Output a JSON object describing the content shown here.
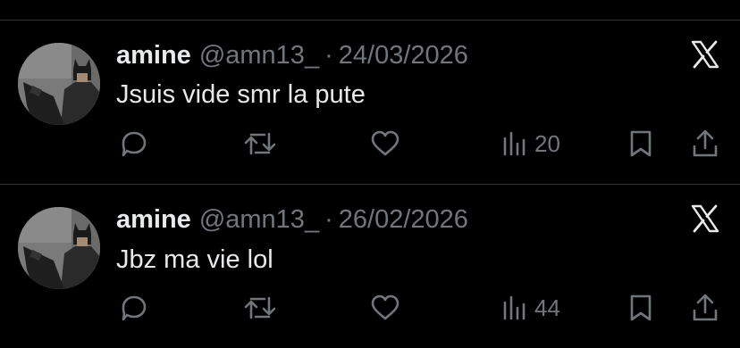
{
  "tweets": [
    {
      "name": "amine",
      "handle": "@amn13_",
      "separator": "·",
      "date": "24/03/2026",
      "text": "Jsuis vide smr la pute",
      "views": "20"
    },
    {
      "name": "amine",
      "handle": "@amn13_",
      "separator": "·",
      "date": "26/02/2026",
      "text": "Jbz ma vie lol",
      "views": "44"
    }
  ],
  "icons": {
    "reply": "comment-icon",
    "repost": "repost-icon",
    "like": "heart-icon",
    "views": "bar-chart-icon",
    "bookmark": "bookmark-icon",
    "share": "share-icon",
    "brand": "x-logo-icon"
  },
  "colors": {
    "background": "#000000",
    "primary_text": "#e7e9ea",
    "secondary_text": "#71767b",
    "divider": "#2f3336"
  }
}
